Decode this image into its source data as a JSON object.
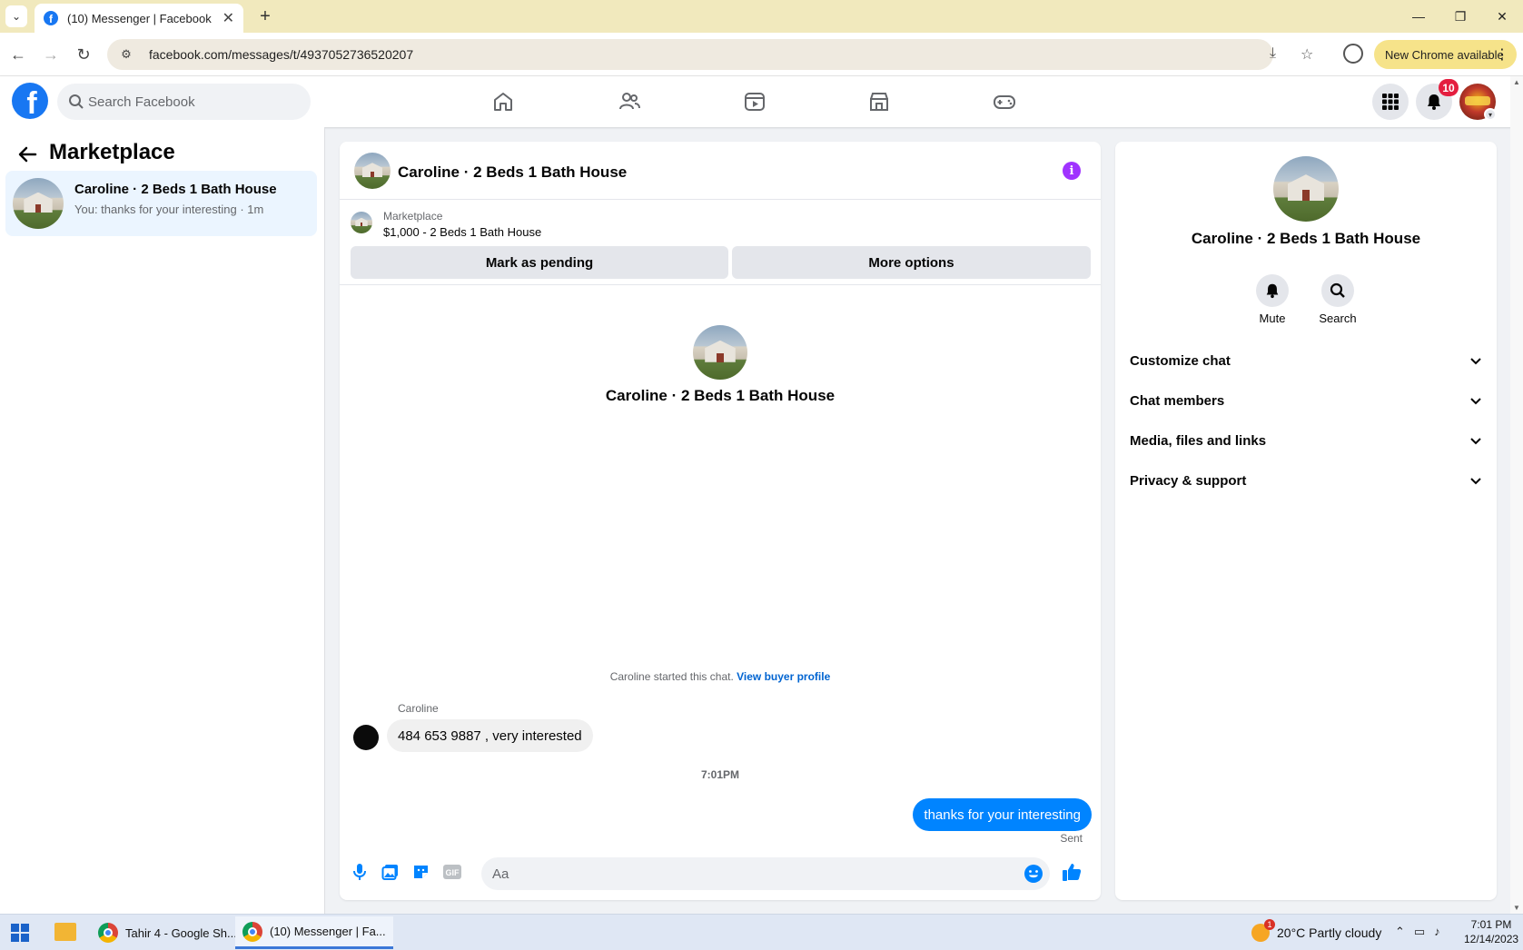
{
  "browser": {
    "tab_title": "(10) Messenger | Facebook",
    "tab_close": "✕",
    "new_tab": "+",
    "url": "facebook.com/messages/t/4937052736520207",
    "new_chrome_label": "New Chrome available",
    "window_controls": {
      "minimize": "—",
      "restore": "❐",
      "close": "✕"
    }
  },
  "facebook": {
    "search_placeholder": "Search Facebook",
    "notification_count": "10",
    "nav_icons": [
      "home-icon",
      "friends-icon",
      "video-icon",
      "marketplace-icon",
      "gaming-icon"
    ]
  },
  "left": {
    "title": "Marketplace",
    "conversation": {
      "name": "Caroline · 2 Beds 1 Bath House",
      "snippet": "You: thanks for your interesting · 1m"
    }
  },
  "chat": {
    "title": "Caroline · 2 Beds 1 Bath House",
    "listing": {
      "source": "Marketplace",
      "title": "$1,000 - 2 Beds 1 Bath House"
    },
    "buttons": {
      "pending": "Mark as pending",
      "more": "More options"
    },
    "intro_name": "Caroline · 2 Beds 1 Bath House",
    "started_text": "Caroline started this chat. ",
    "view_profile": "View buyer profile",
    "messages": [
      {
        "sender": "Caroline",
        "text": "484 653 9887 , very interested",
        "direction": "in"
      },
      {
        "sender": "You",
        "text": "thanks for your interesting",
        "direction": "out",
        "status": "Sent"
      }
    ],
    "time_separator": "7:01PM",
    "composer_placeholder": "Aa"
  },
  "right": {
    "name": "Caroline · 2 Beds 1 Bath House",
    "actions": {
      "mute": "Mute",
      "search": "Search"
    },
    "sections": [
      "Customize chat",
      "Chat members",
      "Media, files and links",
      "Privacy & support"
    ]
  },
  "taskbar": {
    "apps": [
      "Tahir 4 - Google Sh...",
      "(10) Messenger | Fa..."
    ],
    "weather": "20°C  Partly cloudy",
    "time": "7:01 PM",
    "date": "12/14/2023"
  },
  "colors": {
    "fb_blue": "#1877f2",
    "messenger_blue": "#0084ff",
    "info_purple": "#a033ff",
    "badge_red": "#e41e3f"
  }
}
